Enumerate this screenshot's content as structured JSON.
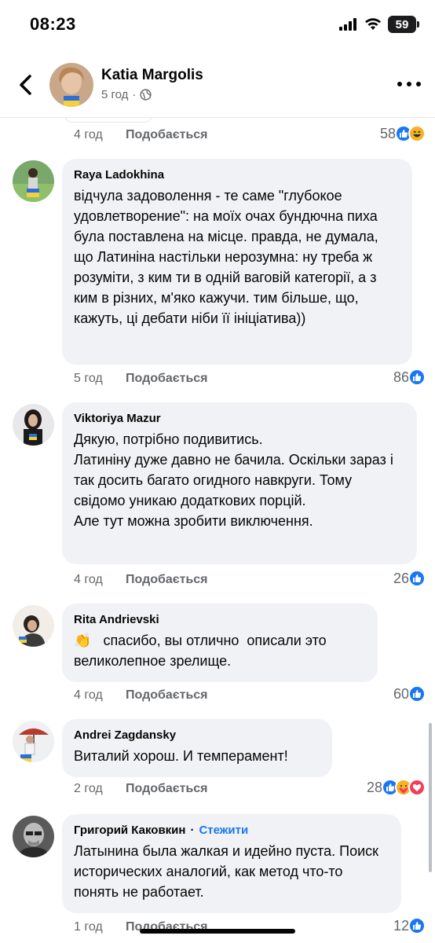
{
  "status_bar": {
    "time": "08:23",
    "battery": "59"
  },
  "header": {
    "author": "Katia Margolis",
    "time": "5 год",
    "audience_icon": "globe-icon"
  },
  "ui": {
    "like_label": "Подобається"
  },
  "top_meta": {
    "time": "4 год",
    "reaction_count": "58",
    "reactions": [
      "like",
      "haha"
    ]
  },
  "comments": [
    {
      "author": "Raya Ladokhina",
      "text": "відчула задоволення - те саме \"глубокое удовлетворение\": на моїх очах бундючна пиха була поставлена на місце. правда, не думала, що Латиніна настільки нерозумна: ну треба ж розуміти, з ким ти в одній ваговій категорії, а з ким в різних, м'яко кажучи. тим більше, що, кажуть, ці дебати ніби її ініціатива))",
      "time": "5 год",
      "reaction_count": "86",
      "reactions": [
        "like"
      ]
    },
    {
      "author": "Viktoriya Mazur",
      "text": "Дякую, потрібно подивитись.\nЛатиніну дуже давно не бачила. Оскільки зараз і так досить багато огидного навкруги. Тому свідомо уникаю додаткових порцій.\nАле тут можна зробити виключення.",
      "time": "4 год",
      "reaction_count": "26",
      "reactions": [
        "like"
      ]
    },
    {
      "author": "Rita Andrievski",
      "emoji": "👏",
      "text": "спасибо, вы отлично  описали это великолепное зрелище.",
      "time": "4 год",
      "reaction_count": "60",
      "reactions": [
        "like"
      ]
    },
    {
      "author": "Andrei Zagdansky",
      "text": "Виталий хорош. И темперамент!",
      "time": "2 год",
      "reaction_count": "28",
      "reactions": [
        "like",
        "care",
        "love"
      ]
    },
    {
      "author": "Григорий Каковкин",
      "follow_label": "Стежити",
      "text": "Латынина была жалкая и идейно пуста. Поиск исторических аналогий, как метод что-то понять не работает.",
      "time": "1 год",
      "reaction_count": "12",
      "reactions": [
        "like"
      ]
    }
  ]
}
